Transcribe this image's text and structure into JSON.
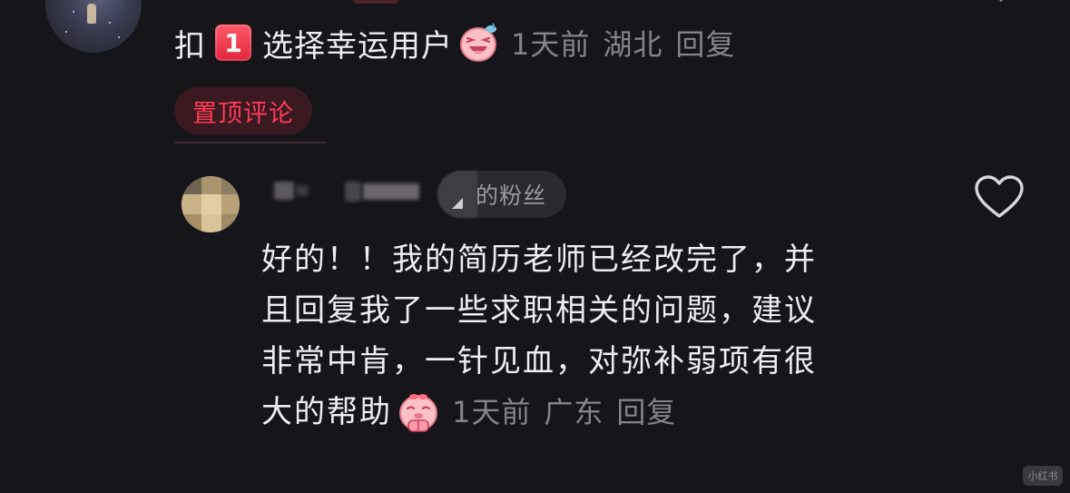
{
  "pinned_comment": {
    "text_before_badge": "扣",
    "badge_number": "1",
    "text_after_badge": "选择幸运用户",
    "emoji": "laughing-pig-emoji",
    "time": "1天前",
    "location": "湖北",
    "reply_label": "回复",
    "pin_tag": "置顶评论"
  },
  "reply_comment": {
    "fan_tag": "的粉丝",
    "lines": [
      "好的！！我的简历老师已经改完了，并",
      "且回复我了一些求职相关的问题，建议",
      "非常中肯，一针见血，对弥补弱项有很"
    ],
    "last_line": "大的帮助",
    "emoji": "begging-pig-emoji",
    "time": "1天前",
    "location": "广东",
    "reply_label": "回复",
    "like_icon": "heart-outline-icon"
  },
  "watermark": {
    "text": "小红书"
  },
  "colors": {
    "background": "#161519",
    "primary_text": "#f0edf1",
    "meta_text": "#86838b",
    "pin_tag_text": "#ff3b55",
    "pin_tag_bg": "#3a1a20",
    "badge_red": "#e3263c"
  }
}
